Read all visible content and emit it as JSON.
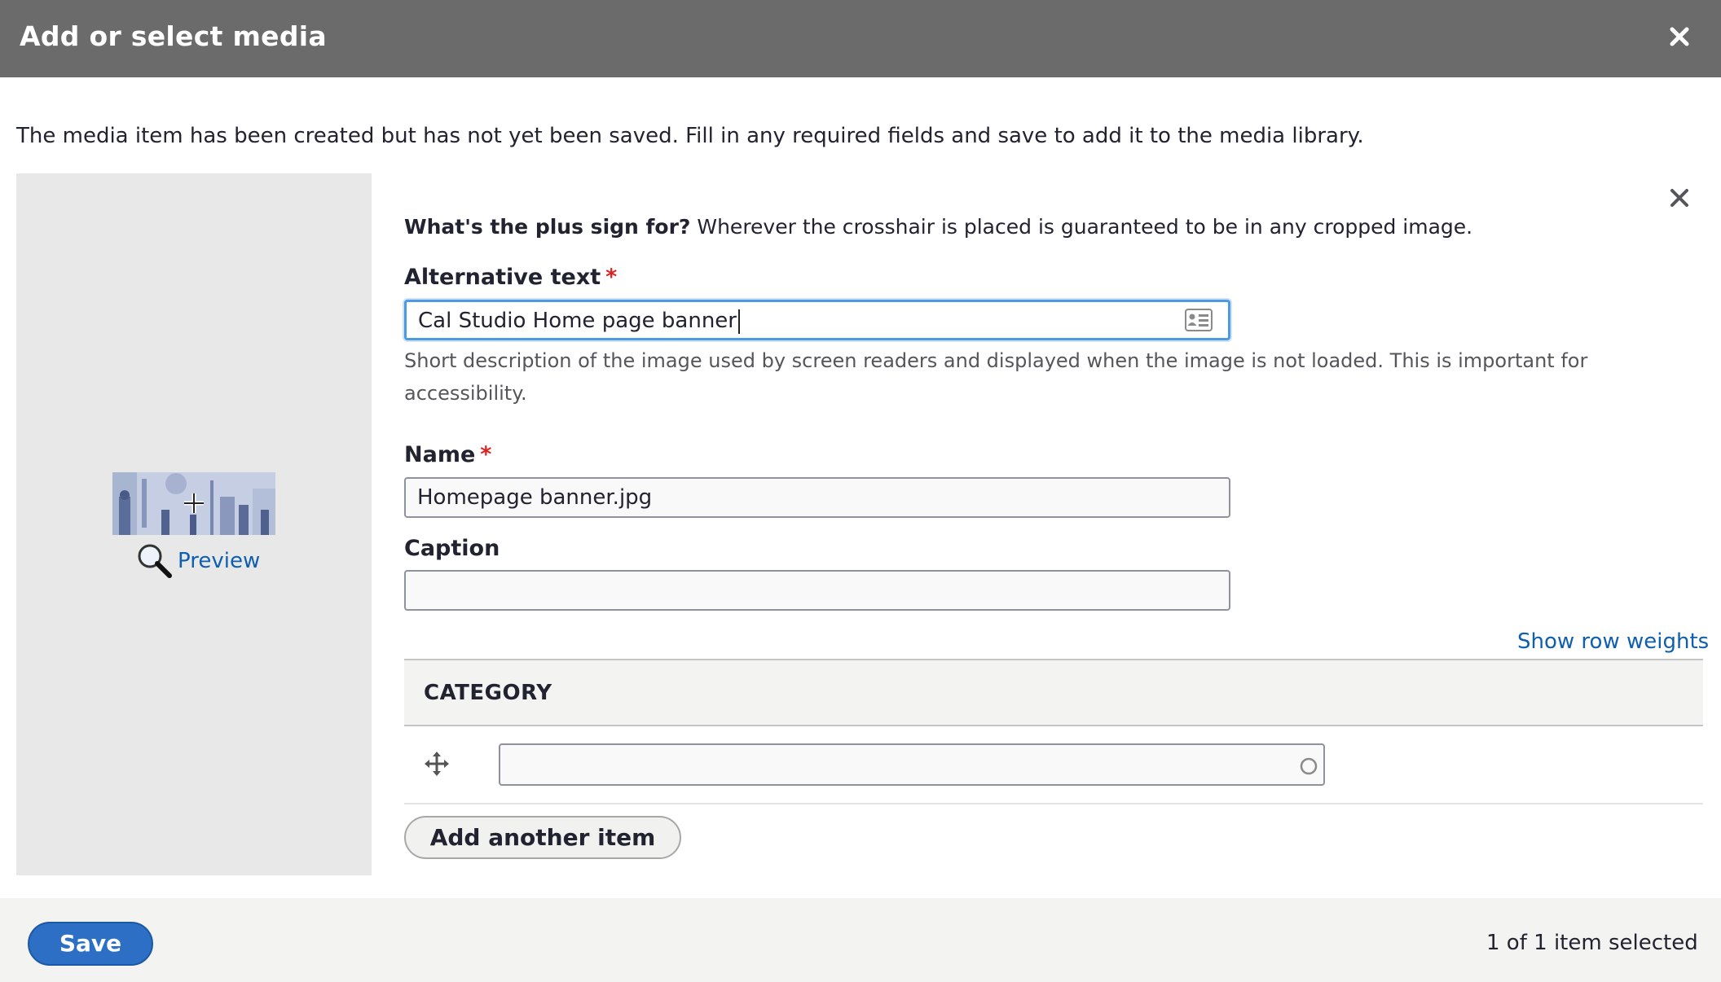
{
  "dialog": {
    "title": "Add or select media",
    "close_icon": "close-icon"
  },
  "notice": "The media item has been created but has not yet been saved. Fill in any required fields and save to add it to the media library.",
  "preview": {
    "link_label": "Preview",
    "icon": "magnifier-icon"
  },
  "focal_hint": {
    "bold": "What's the plus sign for?",
    "text": " Wherever the crosshair is placed is guaranteed to be in any cropped image."
  },
  "fields": {
    "alt_text": {
      "label": "Alternative text",
      "required_mark": "*",
      "value": "Cal Studio Home page banner",
      "description": "Short description of the image used by screen readers and displayed when the image is not loaded. This is important for accessibility."
    },
    "name": {
      "label": "Name",
      "required_mark": "*",
      "value": "Homepage banner.jpg"
    },
    "caption": {
      "label": "Caption",
      "value": ""
    }
  },
  "category": {
    "show_row_weights": "Show row weights",
    "header": "CATEGORY",
    "row_value": "",
    "add_another": "Add another item"
  },
  "footer": {
    "save_label": "Save",
    "selected_count": "1 of 1 item selected"
  },
  "colors": {
    "titlebar": "#6b6b6b",
    "link": "#0f5fae",
    "primary_button": "#2c6fc4",
    "required": "#dc2323",
    "focus_ring": "#4b9ae4"
  }
}
